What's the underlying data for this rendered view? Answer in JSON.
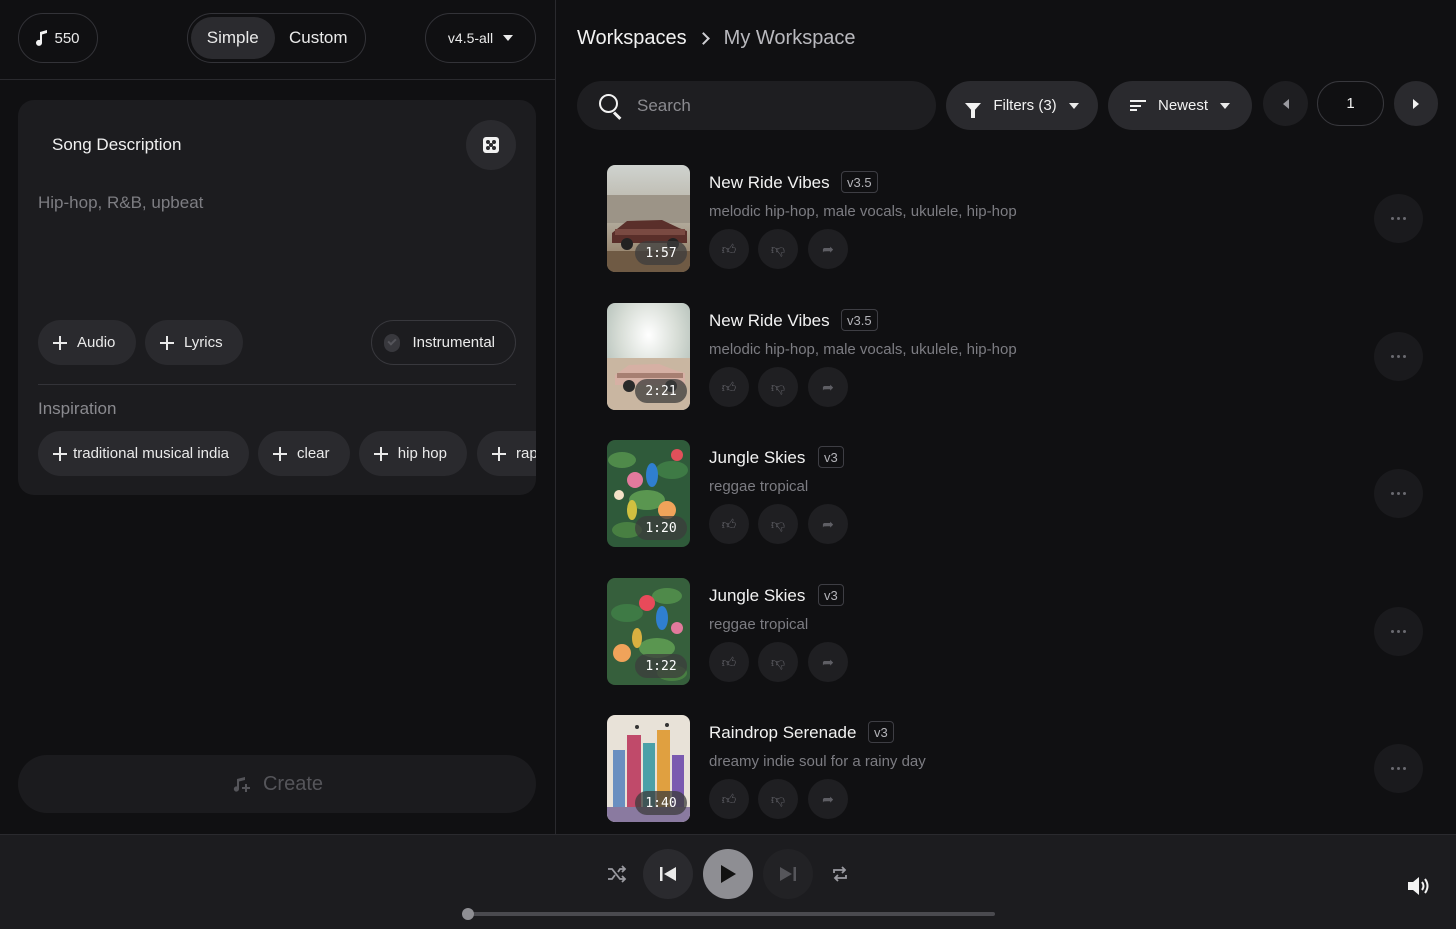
{
  "header": {
    "credits": "550",
    "mode_tabs": [
      "Simple",
      "Custom"
    ],
    "active_mode": "Simple",
    "model_version": "v4.5-all"
  },
  "composer": {
    "title": "Song Description",
    "description_placeholder": "Hip-hop, R&B, upbeat",
    "audio_label": "Audio",
    "lyrics_label": "Lyrics",
    "instrumental_label": "Instrumental",
    "instrumental_checked": false,
    "inspiration_label": "Inspiration",
    "inspiration_chips": [
      "traditional musical india",
      "clear",
      "hip hop",
      "rap"
    ],
    "create_label": "Create"
  },
  "workspace": {
    "breadcrumb": [
      "Workspaces",
      "My Workspace"
    ],
    "search_placeholder": "Search",
    "filters_label": "Filters (3)",
    "sort_label": "Newest",
    "page": "1"
  },
  "songs": [
    {
      "title": "New Ride Vibes",
      "version": "v3.5",
      "tags": "melodic hip-hop, male vocals, ukulele, hip-hop",
      "duration": "1:57",
      "art": "car-desert"
    },
    {
      "title": "New Ride Vibes",
      "version": "v3.5",
      "tags": "melodic hip-hop, male vocals, ukulele, hip-hop",
      "duration": "2:21",
      "art": "car-sun"
    },
    {
      "title": "Jungle Skies",
      "version": "v3",
      "tags": "reggae tropical",
      "duration": "1:20",
      "art": "tropical-birds"
    },
    {
      "title": "Jungle Skies",
      "version": "v3",
      "tags": "reggae tropical",
      "duration": "1:22",
      "art": "tropical-birds"
    },
    {
      "title": "Raindrop Serenade",
      "version": "v3",
      "tags": "dreamy indie soul for a rainy day",
      "duration": "1:40",
      "art": "city-watercolor"
    }
  ],
  "player": {
    "progress": 0.0
  },
  "colors": {
    "background": "#101012",
    "panel": "#1c1c1f",
    "chip": "#2a2a2e",
    "text_primary": "#f2f2f2",
    "text_muted": "#7c7c82"
  }
}
